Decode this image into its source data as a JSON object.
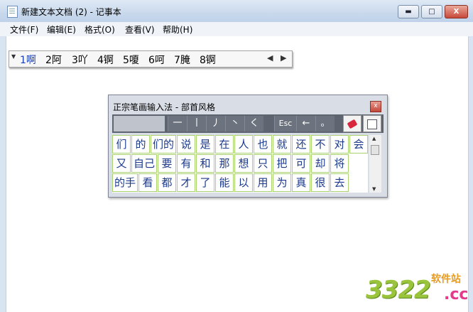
{
  "window": {
    "title": "新建文本文档 (2) - 记事本",
    "min_glyph": "▬",
    "max_glyph": "□",
    "close_glyph": "X"
  },
  "menu": [
    "文件(F)",
    "编辑(E)",
    "格式(O)",
    "查看(V)",
    "帮助(H)"
  ],
  "candidates": {
    "handle_glyph": "▼",
    "items": [
      "1啊",
      "2阿",
      "3吖",
      "4锕",
      "5嗄",
      "6呵",
      "7腌",
      "8锕"
    ],
    "prev_glyph": "◀",
    "next_glyph": "▶"
  },
  "ime": {
    "title": "正宗笔画输入法 - 部首风格",
    "close_glyph": "x",
    "strokes": [
      "一",
      "丨",
      "丿",
      "丶",
      "く"
    ],
    "esc_label": "Esc",
    "backspace_label": "←",
    "period_label": "。",
    "tools": [
      "eraser-icon",
      "notepad-icon"
    ],
    "rows": [
      [
        "们",
        "的",
        "们的",
        "说",
        "是",
        "在",
        "人",
        "也",
        "就",
        "还",
        "不",
        "对",
        "会"
      ],
      [
        "又",
        "自己",
        "要",
        "有",
        "和",
        "那",
        "想",
        "只",
        "把",
        "可",
        "却",
        "将"
      ],
      [
        "的手",
        "看",
        "都",
        "才",
        "了",
        "能",
        "以",
        "用",
        "为",
        "真",
        "很",
        "去"
      ]
    ],
    "scroll_up": "▲",
    "scroll_down": "▼"
  },
  "watermark": {
    "digits": "3322",
    "site": "软件站",
    "tld": ".cc"
  }
}
